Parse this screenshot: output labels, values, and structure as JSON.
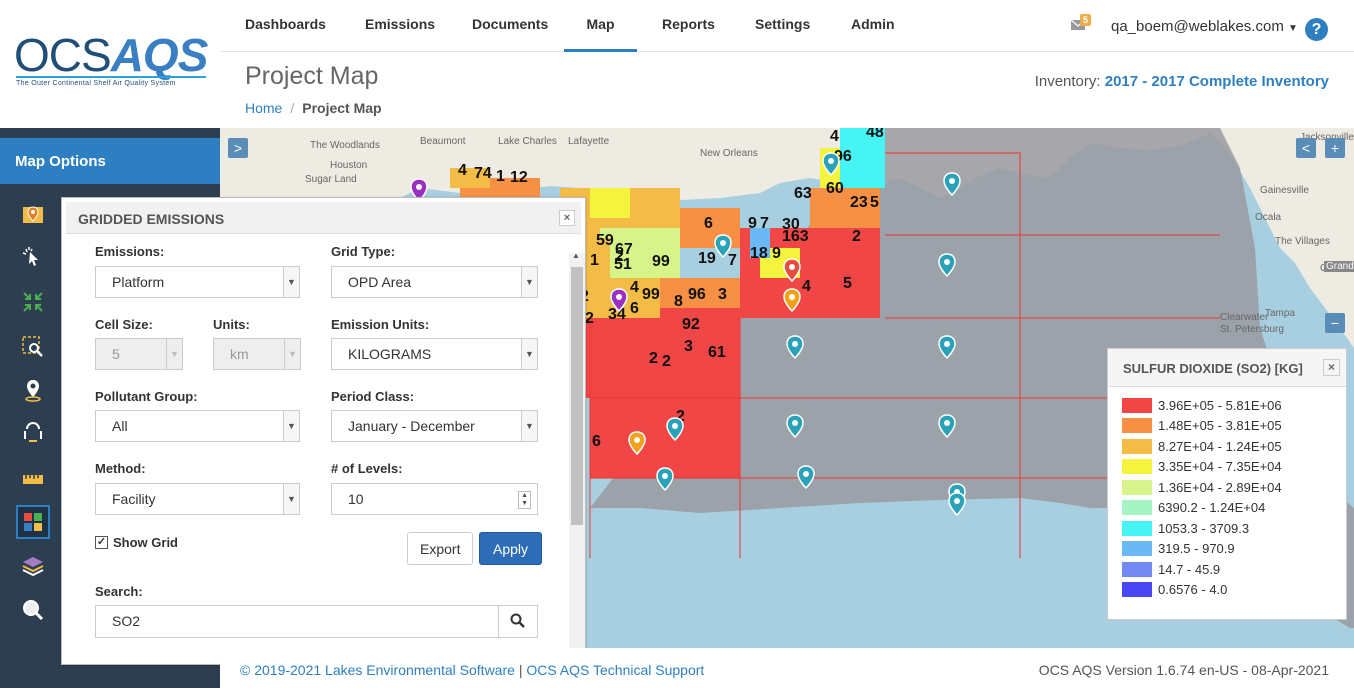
{
  "app": {
    "logo_ocs": "OCS",
    "logo_aqs": "AQS",
    "logo_tagline": "The Outer Continental Shelf Air Quality System"
  },
  "sidebar": {
    "header": "Map Options",
    "tools": [
      {
        "icon": "map-marker-layer-icon"
      },
      {
        "icon": "select-pointer-icon"
      },
      {
        "icon": "compress-arrows-icon"
      },
      {
        "icon": "zoom-area-icon"
      },
      {
        "icon": "location-pin-icon"
      },
      {
        "icon": "query-icon"
      },
      {
        "icon": "ruler-icon"
      },
      {
        "icon": "grid-icon",
        "active": true
      },
      {
        "icon": "layers-icon"
      },
      {
        "icon": "search-map-icon"
      }
    ]
  },
  "nav": {
    "items": [
      "Dashboards",
      "Emissions",
      "Documents",
      "Map",
      "Reports",
      "Settings",
      "Admin"
    ],
    "active": "Map",
    "mail_count": "5",
    "user": "qa_boem@weblakes.com",
    "help": "?"
  },
  "page": {
    "title": "Project Map",
    "inventory_label": "Inventory:",
    "inventory_value": "2017 - 2017 Complete Inventory",
    "breadcrumb_home": "Home",
    "breadcrumb_sep": "/",
    "breadcrumb_current": "Project Map"
  },
  "map": {
    "place_labels": [
      "The Woodlands",
      "Beaumont",
      "Lake Charles",
      "Lafayette",
      "New Orleans",
      "Houston",
      "Sugar Land",
      "Jacksonville",
      "Gainesville",
      "The Villages",
      "Orlando",
      "Clearwater",
      "Tampa",
      "St. Petersburg",
      "Ocala",
      "Grand"
    ],
    "cell_labels": [
      "4",
      "74",
      "1",
      "12",
      "4",
      "96",
      "48",
      "63",
      "60",
      "23",
      "5",
      "9",
      "7",
      "6",
      "2",
      "67",
      "19",
      "3",
      "7",
      "18",
      "9",
      "30",
      "163",
      "2",
      "4",
      "5",
      "1",
      "59",
      "51",
      "99",
      "8",
      "96",
      "3",
      "6",
      "4",
      "99",
      "3",
      "2",
      "61",
      "2",
      "2",
      "9",
      "6",
      "34",
      "2",
      "92",
      "2"
    ],
    "zoom_in": "+",
    "zoom_out": "−",
    "expand": ">",
    "nav_left": "<"
  },
  "legend": {
    "title": "SULFUR DIOXIDE (SO2) [KG]",
    "close": "×",
    "items": [
      {
        "label": "3.96E+05 - 5.81E+06",
        "color": "#f04646"
      },
      {
        "label": "1.48E+05 - 3.81E+05",
        "color": "#f59045"
      },
      {
        "label": "8.27E+04 - 1.24E+05",
        "color": "#f3bc46"
      },
      {
        "label": "3.35E+04 - 7.35E+04",
        "color": "#f4f43f"
      },
      {
        "label": "1.36E+04 - 2.89E+04",
        "color": "#d7f48a"
      },
      {
        "label": "6390.2 - 1.24E+04",
        "color": "#a6f4c4"
      },
      {
        "label": "1053.3 - 3709.3",
        "color": "#47f4f4"
      },
      {
        "label": "319.5 - 970.9",
        "color": "#6bb9f4"
      },
      {
        "label": "14.7 - 45.9",
        "color": "#7389f4"
      },
      {
        "label": "0.6576 - 4.0",
        "color": "#4a46f4"
      }
    ]
  },
  "panel": {
    "title": "GRIDDED EMISSIONS",
    "close": "×",
    "emissions_label": "Emissions:",
    "emissions_value": "Platform",
    "grid_type_label": "Grid Type:",
    "grid_type_value": "OPD Area",
    "cell_size_label": "Cell Size:",
    "cell_size_value": "5",
    "units_label": "Units:",
    "units_value": "km",
    "emission_units_label": "Emission Units:",
    "emission_units_value": "KILOGRAMS",
    "pollutant_group_label": "Pollutant Group:",
    "pollutant_group_value": "All",
    "period_class_label": "Period Class:",
    "period_class_value": "January - December",
    "method_label": "Method:",
    "method_value": "Facility",
    "levels_label": "# of Levels:",
    "levels_value": "10",
    "show_grid_label": "Show Grid",
    "show_grid_checked": true,
    "export_label": "Export",
    "apply_label": "Apply",
    "search_label": "Search:",
    "search_value": "SO2"
  },
  "footer": {
    "copyright": "© 2019-2021 Lakes Environmental Software",
    "sep": "|",
    "support": "OCS AQS Technical Support",
    "version": "OCS AQS Version 1.6.74 en-US - 08-Apr-2021"
  }
}
